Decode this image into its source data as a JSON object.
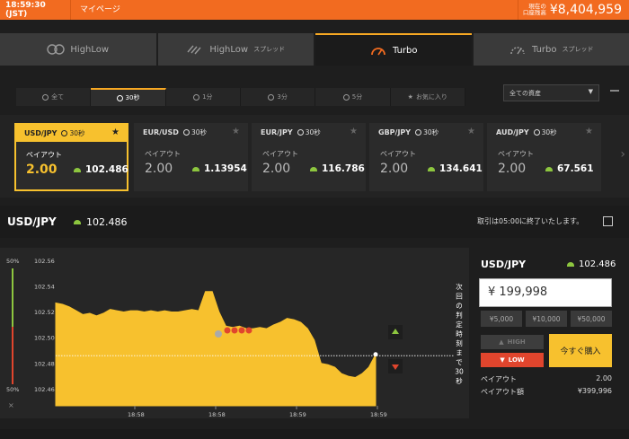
{
  "header": {
    "time": "18:59:30 (JST)",
    "mypage": "マイページ",
    "balance_label_1": "現在の",
    "balance_label_2": "口座残高",
    "balance": "¥8,404,959"
  },
  "mode_tabs": [
    {
      "label": "HighLow",
      "sub": "",
      "icon": "highlow-icon"
    },
    {
      "label": "HighLow",
      "sub": "スプレッド",
      "icon": "highlow-spread-icon"
    },
    {
      "label": "Turbo",
      "sub": "",
      "icon": "turbo-gauge-icon",
      "active": true
    },
    {
      "label": "Turbo",
      "sub": "スプレッド",
      "icon": "turbo-spread-icon"
    }
  ],
  "time_tabs": [
    {
      "label": "全て"
    },
    {
      "label": "30秒",
      "active": true
    },
    {
      "label": "1分"
    },
    {
      "label": "3分"
    },
    {
      "label": "5分"
    },
    {
      "label": "お気に入り"
    }
  ],
  "asset_select": {
    "value": "全ての資産"
  },
  "cards": [
    {
      "symbol": "USD/JPY",
      "duration": "30秒",
      "payout_label": "ペイアウト",
      "payout": "2.00",
      "price": "102.486",
      "active": true
    },
    {
      "symbol": "EUR/USD",
      "duration": "30秒",
      "payout_label": "ペイアウト",
      "payout": "2.00",
      "price": "1.13954"
    },
    {
      "symbol": "EUR/JPY",
      "duration": "30秒",
      "payout_label": "ペイアウト",
      "payout": "2.00",
      "price": "116.786"
    },
    {
      "symbol": "GBP/JPY",
      "duration": "30秒",
      "payout_label": "ペイアウト",
      "payout": "2.00",
      "price": "134.641"
    },
    {
      "symbol": "AUD/JPY",
      "duration": "30秒",
      "payout_label": "ペイアウト",
      "payout": "2.00",
      "price": "67.561"
    }
  ],
  "chart_header": {
    "symbol": "USD/JPY",
    "price": "102.486",
    "notice": "取引は05:00に終了いたします。"
  },
  "gauge": {
    "top": "50%",
    "bottom": "50%",
    "close": "×"
  },
  "chart_data": {
    "type": "area",
    "y_ticks": [
      "102.56",
      "102.54",
      "102.52",
      "102.50",
      "102.48",
      "102.46"
    ],
    "ylim": [
      102.447,
      102.57
    ],
    "x_ticks": [
      "18:58",
      "18:58",
      "18:59",
      "18:59"
    ],
    "values": [
      102.527,
      102.526,
      102.524,
      102.521,
      102.518,
      102.519,
      102.517,
      102.519,
      102.522,
      102.521,
      102.52,
      102.521,
      102.521,
      102.52,
      102.521,
      102.52,
      102.521,
      102.52,
      102.52,
      102.521,
      102.522,
      102.521,
      102.536,
      102.536,
      102.52,
      102.509,
      102.508,
      102.509,
      102.507,
      102.507,
      102.508,
      102.507,
      102.51,
      102.512,
      102.515,
      102.514,
      102.512,
      102.507,
      102.498,
      102.48,
      102.479,
      102.477,
      102.472,
      102.47,
      102.469,
      102.472,
      102.477,
      102.487
    ],
    "strike": 102.486,
    "countdown": "次回の判定時刻まで30秒"
  },
  "trade_panel": {
    "symbol": "USD/JPY",
    "price": "102.486",
    "amount": "¥ 199,998",
    "quick": [
      "¥5,000",
      "¥10,000",
      "¥50,000"
    ],
    "high": "HIGH",
    "low": "LOW",
    "buy": "今すぐ購入",
    "payout_label": "ペイアウト",
    "payout": "2.00",
    "payout_amount_label": "ペイアウト額",
    "payout_amount": "¥399,996"
  },
  "colors": {
    "accent": "#f26b20",
    "gold": "#f7c12e",
    "up": "#8dc63f",
    "down": "#e0452d"
  }
}
